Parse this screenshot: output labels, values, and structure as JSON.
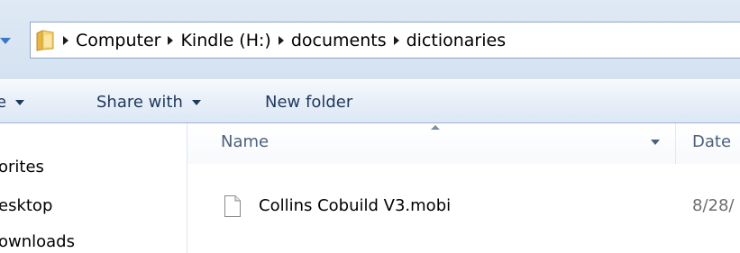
{
  "address_bar": {
    "breadcrumbs": [
      "Computer",
      "Kindle (H:)",
      "documents",
      "dictionaries"
    ]
  },
  "toolbar": {
    "organize_label_fragment": "e",
    "share_with_label": "Share with",
    "new_folder_label": "New folder"
  },
  "navigation": {
    "items": [
      "orites",
      "esktop",
      "ownloads"
    ]
  },
  "file_list": {
    "columns": {
      "name": "Name",
      "date": "Date"
    },
    "files": [
      {
        "name": "Collins Cobuild V3.mobi",
        "date": "8/28/"
      }
    ]
  },
  "icons": {
    "address_folder": "folder-icon",
    "breadcrumb_separator": "chevron-right-icon",
    "file": "document-icon"
  },
  "colors": {
    "chrome_background": "#d5e2f1",
    "toolbar_text": "#1e395b",
    "header_text": "#4c607a"
  }
}
